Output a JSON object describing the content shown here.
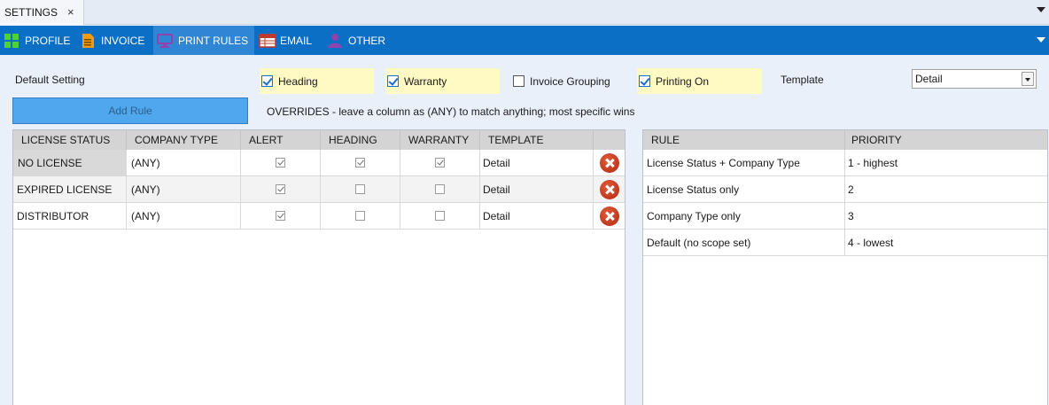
{
  "doc_tab": {
    "title": "SETTINGS",
    "close": "×"
  },
  "toolbar": {
    "items": [
      {
        "label": "PROFILE",
        "icon": "windows-grid-icon"
      },
      {
        "label": "INVOICE",
        "icon": "document-icon"
      },
      {
        "label": "PRINT RULES",
        "icon": "monitor-icon",
        "active": true
      },
      {
        "label": "EMAIL",
        "icon": "email-table-icon"
      },
      {
        "label": "OTHER",
        "icon": "user-icon"
      }
    ]
  },
  "defaults": {
    "label": "Default Setting",
    "heading": {
      "label": "Heading",
      "checked": true
    },
    "warranty": {
      "label": "Warranty",
      "checked": true
    },
    "invoice_grouping": {
      "label": "Invoice Grouping",
      "checked": false
    },
    "printing_on": {
      "label": "Printing On",
      "checked": true
    },
    "template_label": "Template",
    "template_value": "Detail"
  },
  "add_rule_label": "Add Rule",
  "overrides_text": "OVERRIDES - leave a column as (ANY) to match anything; most specific wins",
  "rules_table": {
    "headers": [
      "LICENSE STATUS",
      "COMPANY TYPE",
      "ALERT",
      "HEADING",
      "WARRANTY",
      "TEMPLATE"
    ],
    "rows": [
      {
        "license_status": "NO LICENSE",
        "company_type": "(ANY)",
        "alert": true,
        "heading": true,
        "warranty": true,
        "template": "Detail"
      },
      {
        "license_status": "EXPIRED LICENSE",
        "company_type": "(ANY)",
        "alert": true,
        "heading": false,
        "warranty": false,
        "template": "Detail"
      },
      {
        "license_status": "DISTRIBUTOR",
        "company_type": "(ANY)",
        "alert": true,
        "heading": false,
        "warranty": false,
        "template": "Detail"
      }
    ]
  },
  "priority_table": {
    "headers": [
      "RULE",
      "PRIORITY"
    ],
    "rows": [
      {
        "rule": "License Status + Company Type",
        "priority": "1 - highest"
      },
      {
        "rule": "License Status only",
        "priority": "2"
      },
      {
        "rule": "Company Type only",
        "priority": "3"
      },
      {
        "rule": "Default (no scope set)",
        "priority": "4 - lowest"
      }
    ]
  },
  "colors": {
    "toolbar_blue": "#0b6fc6",
    "active_tab": "#2f86d4",
    "highlight_yellow": "#fff9c4",
    "add_rule_blue": "#4fa7ed"
  }
}
